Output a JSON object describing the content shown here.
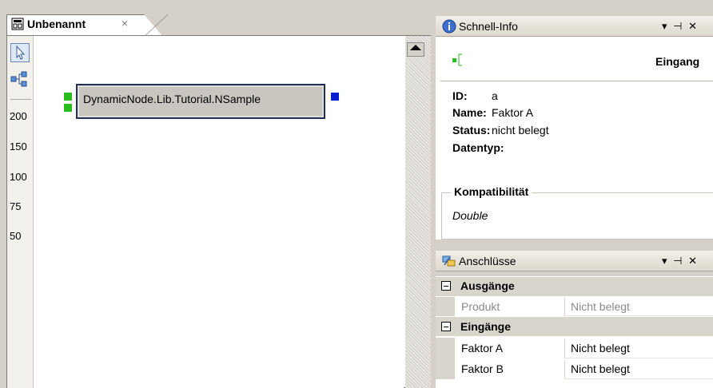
{
  "document": {
    "tab_title": "Unbenannt",
    "tab_close": "×",
    "tab_icon": "document-icon",
    "tools": [
      {
        "name": "pointer-tool",
        "icon": "cursor-arrow-icon"
      },
      {
        "name": "layout-tool",
        "icon": "tree-layout-icon"
      }
    ],
    "zoom_levels": [
      "200",
      "150",
      "100",
      "75",
      "50"
    ],
    "node": {
      "label": "DynamicNode.Lib.Tutorial.NSample",
      "input_port_color": "#2bbd1f",
      "output_port_color": "#0020d0"
    }
  },
  "quick_info": {
    "title": "Schnell-Info",
    "icon": "info-icon",
    "controls": "▾ ⊣ ✕",
    "type_label": "Eingang",
    "fields": [
      {
        "label": "ID:",
        "value": "a"
      },
      {
        "label": "Name:",
        "value": "Faktor A"
      },
      {
        "label": "Status:",
        "value": "nicht belegt"
      },
      {
        "label": "Datentyp:",
        "value": ""
      }
    ],
    "compat_title": "Kompatibilität",
    "compat_value": "Double"
  },
  "connections": {
    "title": "Anschlüsse",
    "icon": "connections-icon",
    "controls": "▾ ⊣ ✕",
    "groups": [
      {
        "label": "Ausgänge",
        "rows": [
          {
            "name": "Produkt",
            "value": "Nicht belegt",
            "disabled": true
          }
        ]
      },
      {
        "label": "Eingänge",
        "rows": [
          {
            "name": "Faktor A",
            "value": "Nicht belegt",
            "disabled": false
          },
          {
            "name": "Faktor B",
            "value": "Nicht belegt",
            "disabled": false
          }
        ]
      }
    ]
  }
}
